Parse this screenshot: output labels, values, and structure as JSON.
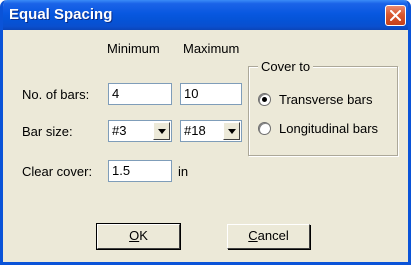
{
  "window": {
    "title": "Equal Spacing",
    "close_icon": "close-x-icon",
    "titlebar_color": "#0858e0",
    "close_color": "#d9582f"
  },
  "columns": {
    "minimum": "Minimum",
    "maximum": "Maximum"
  },
  "rows": {
    "bars_label": "No. of bars:",
    "bars_min": "4",
    "bars_max": "10",
    "size_label": "Bar size:",
    "size_min": "#3",
    "size_max": "#18",
    "cover_label": "Clear cover:",
    "cover_value": "1.5",
    "cover_unit": "in"
  },
  "cover_to": {
    "legend": "Cover to",
    "options": [
      {
        "label": "Transverse bars",
        "selected": true
      },
      {
        "label": "Longitudinal bars",
        "selected": false
      }
    ]
  },
  "buttons": {
    "ok_mnemonic": "O",
    "ok_rest": "K",
    "cancel_mnemonic": "C",
    "cancel_rest": "ancel"
  }
}
